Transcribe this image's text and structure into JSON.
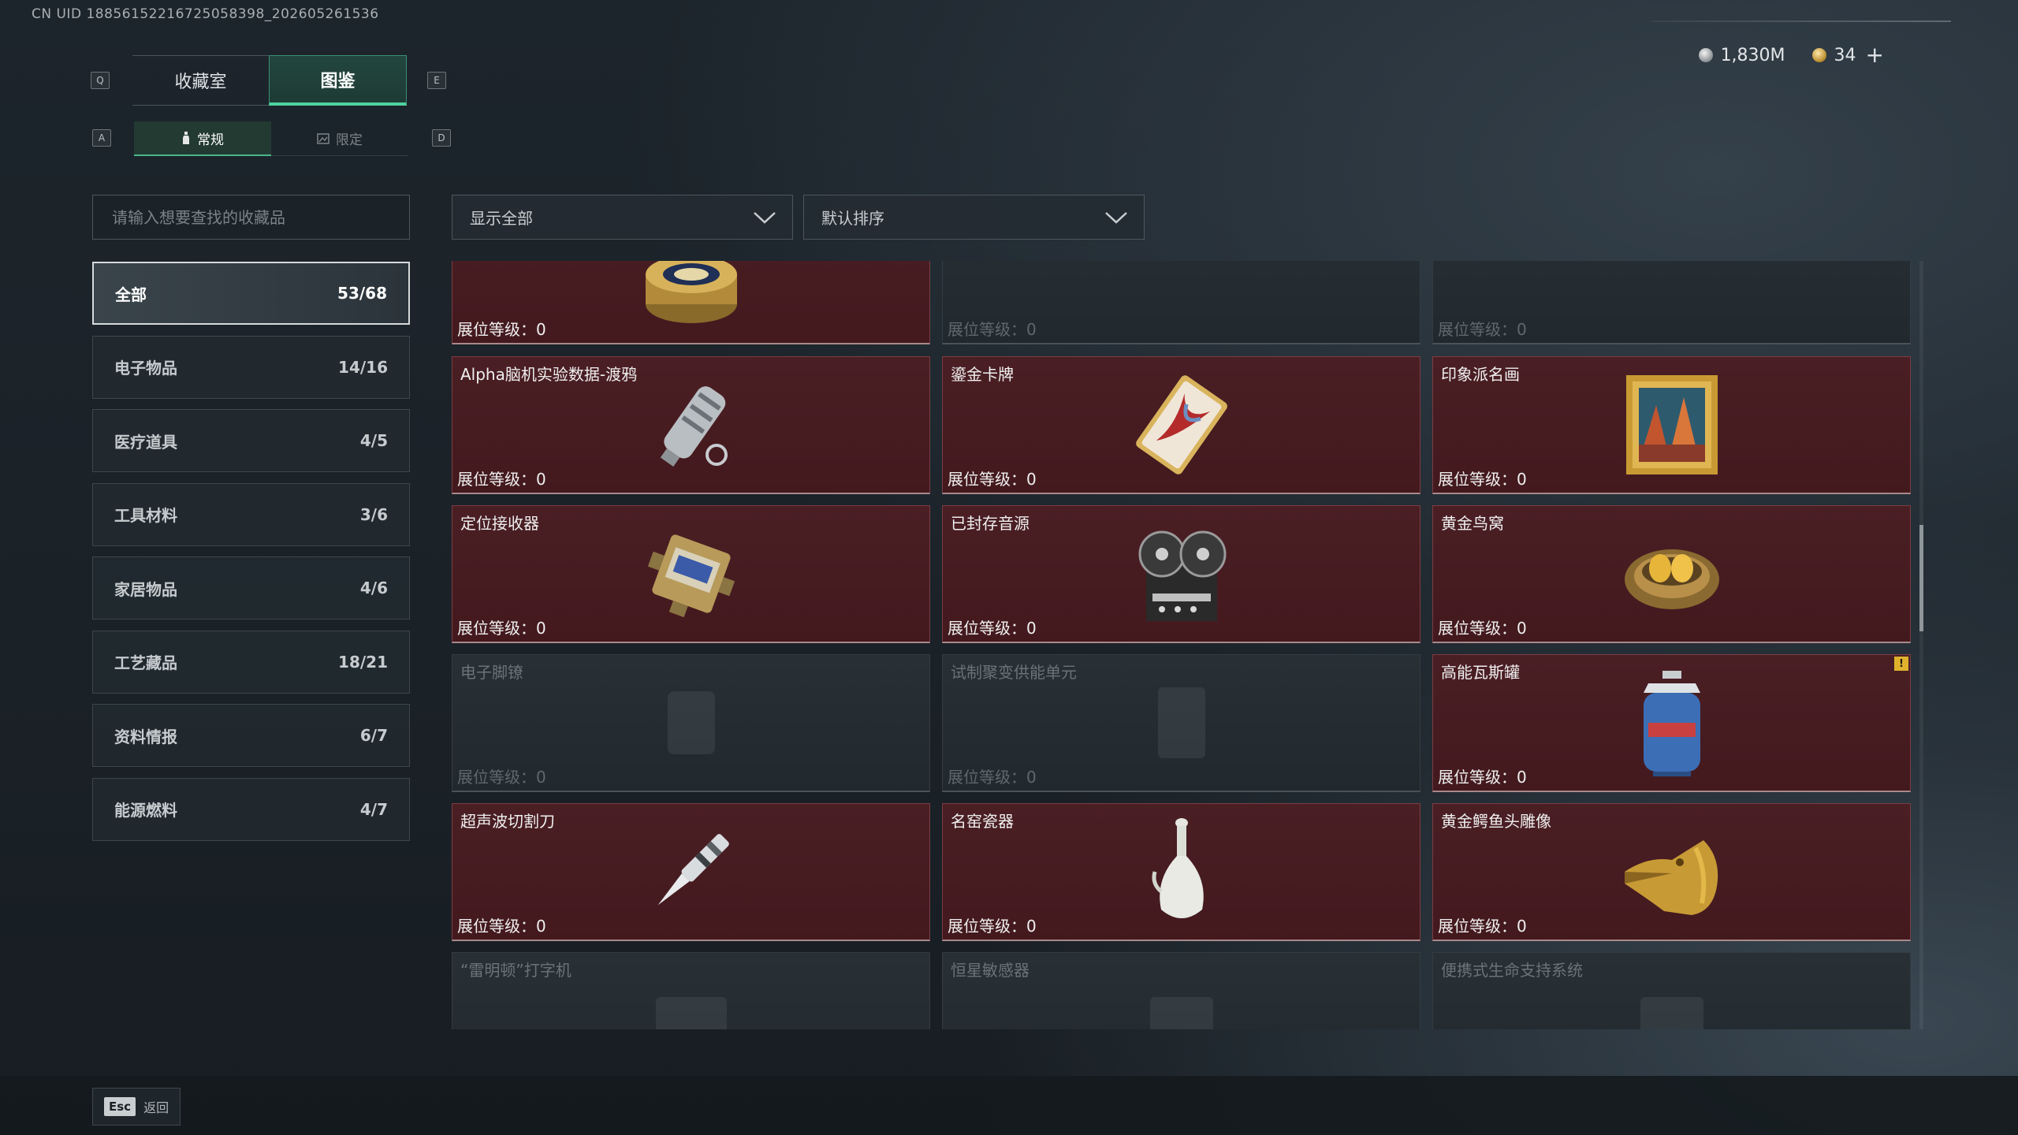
{
  "uid_text": "CN UID 1885615221672505839​8_202605261536",
  "currency": {
    "silver": "1,830M",
    "gold": "34",
    "plus": "+"
  },
  "keys": {
    "prev_tab": "Q",
    "next_tab": "E",
    "prev_sub": "A",
    "next_sub": "D"
  },
  "main_tabs": [
    {
      "label": "收藏室"
    },
    {
      "label": "图鉴"
    }
  ],
  "sub_tabs": [
    {
      "label": "常规"
    },
    {
      "label": "限定"
    }
  ],
  "search": {
    "placeholder": "请输入想要查找的收藏品"
  },
  "filter": {
    "value": "显示全部"
  },
  "sort": {
    "value": "默认排序"
  },
  "categories": [
    {
      "name": "全部",
      "count": "53/68"
    },
    {
      "name": "电子物品",
      "count": "14/16"
    },
    {
      "name": "医疗道具",
      "count": "4/5"
    },
    {
      "name": "工具材料",
      "count": "3/6"
    },
    {
      "name": "家居物品",
      "count": "4/6"
    },
    {
      "name": "工艺藏品",
      "count": "18/21"
    },
    {
      "name": "资料情报",
      "count": "6/7"
    },
    {
      "name": "能源燃料",
      "count": "4/7"
    }
  ],
  "level_label": "展位等级：",
  "items": [
    {
      "name": "",
      "level": "0",
      "owned": true,
      "icon": "caviar-tin-icon"
    },
    {
      "name": "",
      "level": "0",
      "owned": false,
      "icon": "locked-item-icon"
    },
    {
      "name": "",
      "level": "0",
      "owned": false,
      "icon": "locked-item-icon"
    },
    {
      "name": "Alpha脑机实验数据-渡鸦",
      "level": "0",
      "owned": true,
      "icon": "data-capsule-icon"
    },
    {
      "name": "鎏金卡牌",
      "level": "0",
      "owned": true,
      "icon": "gilded-card-icon"
    },
    {
      "name": "印象派名画",
      "level": "0",
      "owned": true,
      "icon": "framed-painting-icon"
    },
    {
      "name": "定位接收器",
      "level": "0",
      "owned": true,
      "icon": "locator-receiver-icon"
    },
    {
      "name": "已封存音源",
      "level": "0",
      "owned": true,
      "icon": "reel-recorder-icon"
    },
    {
      "name": "黄金鸟窝",
      "level": "0",
      "owned": true,
      "icon": "golden-nest-icon"
    },
    {
      "name": "电子脚镣",
      "level": "0",
      "owned": false,
      "icon": "ankle-monitor-icon"
    },
    {
      "name": "试制聚变供能单元",
      "level": "0",
      "owned": false,
      "icon": "fusion-cell-icon"
    },
    {
      "name": "高能瓦斯罐",
      "level": "0",
      "owned": true,
      "icon": "gas-canister-icon",
      "badge": "!"
    },
    {
      "name": "超声波切割刀",
      "level": "0",
      "owned": true,
      "icon": "ultrasonic-knife-icon"
    },
    {
      "name": "名窑瓷器",
      "level": "0",
      "owned": true,
      "icon": "porcelain-vase-icon"
    },
    {
      "name": "黄金鳄鱼头雕像",
      "level": "0",
      "owned": true,
      "icon": "gold-crocodile-icon"
    },
    {
      "name": "“雷明顿”打字机",
      "level": "",
      "owned": false,
      "icon": "typewriter-icon"
    },
    {
      "name": "恒星敏感器",
      "level": "",
      "owned": false,
      "icon": "star-sensor-icon"
    },
    {
      "name": "便携式生命支持系统",
      "level": "",
      "owned": false,
      "icon": "life-support-icon"
    }
  ],
  "bottom": {
    "esc_key": "Esc",
    "esc_label": "返回"
  },
  "colors": {
    "accent": "#4fd29e",
    "owned_card": "#4a1f24",
    "locked_card": "#262d32",
    "badge": "#e0b22c"
  }
}
